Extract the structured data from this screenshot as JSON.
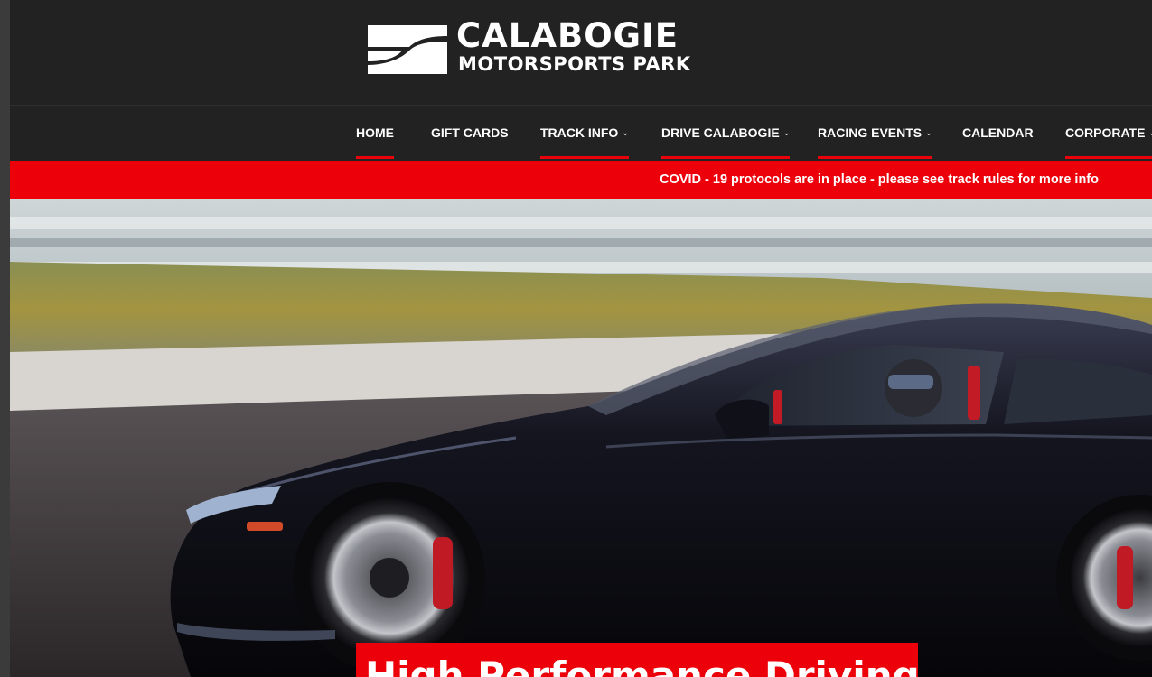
{
  "logo": {
    "line1": "CALABOGIE",
    "line2": "MOTORSPORTS PARK"
  },
  "nav": {
    "items": [
      {
        "label": "HOME",
        "active": true,
        "has_dropdown": false
      },
      {
        "label": "GIFT CARDS",
        "active": false,
        "has_dropdown": false
      },
      {
        "label": "TRACK INFO",
        "active": true,
        "has_dropdown": true
      },
      {
        "label": "DRIVE CALABOGIE",
        "active": true,
        "has_dropdown": true
      },
      {
        "label": "RACING EVENTS",
        "active": true,
        "has_dropdown": true
      },
      {
        "label": "CALENDAR",
        "active": false,
        "has_dropdown": false
      },
      {
        "label": "CORPORATE",
        "active": true,
        "has_dropdown": true
      }
    ]
  },
  "alert": {
    "text": "COVID - 19 protocols are in place - please see track rules for more info"
  },
  "hero": {
    "title": "High Performance Driving"
  },
  "colors": {
    "accent_red": "#ec0009",
    "header_bg": "#222223",
    "text": "#ffffff"
  }
}
